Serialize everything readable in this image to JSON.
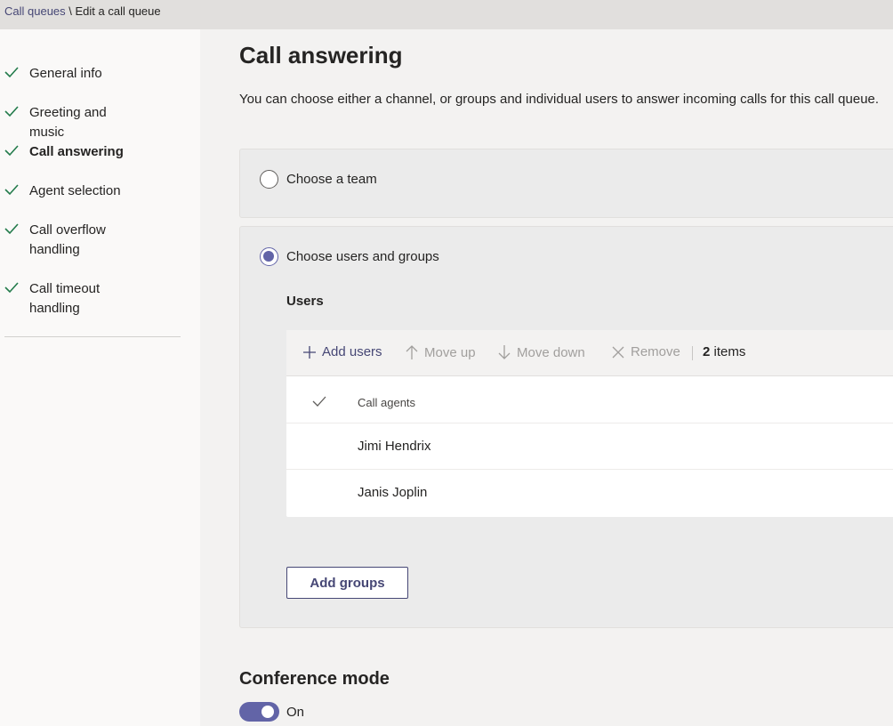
{
  "breadcrumb": {
    "parent": "Call queues",
    "separator": " \\ ",
    "current": "Edit a call queue"
  },
  "sidebar": {
    "items": [
      {
        "label": "General info",
        "done": true,
        "active": false
      },
      {
        "label": "Greeting and music",
        "done": true,
        "active": false
      },
      {
        "label": "Call answering",
        "done": true,
        "active": true
      },
      {
        "label": "Agent selection",
        "done": true,
        "active": false
      },
      {
        "label": "Call overflow handling",
        "done": true,
        "active": false
      },
      {
        "label": "Call timeout handling",
        "done": true,
        "active": false
      }
    ]
  },
  "main": {
    "title": "Call answering",
    "description": "You can choose either a channel, or groups and individual users to answer incoming calls for this call queue.",
    "option_team": {
      "label": "Choose a team",
      "selected": false
    },
    "option_users": {
      "label": "Choose users and groups",
      "selected": true
    },
    "users_title": "Users",
    "commands": {
      "add_users": "Add users",
      "move_up": "Move up",
      "move_down": "Move down",
      "remove": "Remove",
      "count_number": "2",
      "count_label": " items"
    },
    "table": {
      "header": "Call agents",
      "rows": [
        "Jimi Hendrix",
        "Janis Joplin"
      ]
    },
    "add_groups": "Add groups",
    "conference_title": "Conference mode",
    "conference_toggle": {
      "label": "On",
      "on": true
    }
  },
  "colors": {
    "accent": "#6264a7",
    "link": "#464775",
    "check": "#237b4b"
  }
}
